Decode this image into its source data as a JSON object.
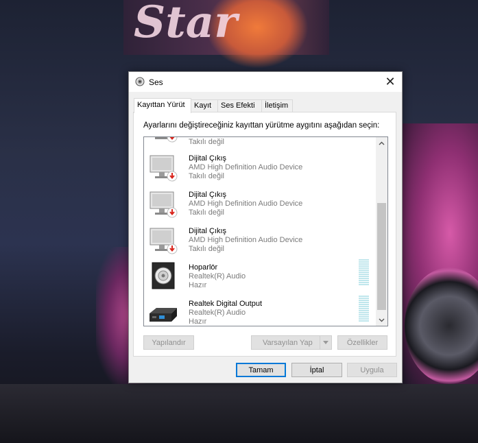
{
  "window": {
    "title": "Ses",
    "close_glyph": "✕"
  },
  "tabs": [
    {
      "label": "Kayıttan Yürüt",
      "active": true
    },
    {
      "label": "Kayıt",
      "active": false
    },
    {
      "label": "Ses Efekti",
      "active": false
    },
    {
      "label": "İletişim",
      "active": false
    }
  ],
  "instruction": "Ayarlarını değiştireceğiniz kayıttan yürütme aygıtını aşağıdan seçin:",
  "devices": [
    {
      "name": "",
      "description": "",
      "status": "Takılı değil",
      "icon": "monitor-disconnected-icon"
    },
    {
      "name": "Dijital Çıkış",
      "description": "AMD High Definition Audio Device",
      "status": "Takılı değil",
      "icon": "monitor-disconnected-icon"
    },
    {
      "name": "Dijital Çıkış",
      "description": "AMD High Definition Audio Device",
      "status": "Takılı değil",
      "icon": "monitor-disconnected-icon"
    },
    {
      "name": "Dijital Çıkış",
      "description": "AMD High Definition Audio Device",
      "status": "Takılı değil",
      "icon": "monitor-disconnected-icon"
    },
    {
      "name": "Hoparlör",
      "description": "Realtek(R) Audio",
      "status": "Hazır",
      "icon": "speaker-icon"
    },
    {
      "name": "Realtek Digital Output",
      "description": "Realtek(R) Audio",
      "status": "Hazır",
      "icon": "digital-output-icon"
    }
  ],
  "buttons": {
    "configure": "Yapılandır",
    "set_default": "Varsayılan Yap",
    "properties": "Özellikler",
    "ok": "Tamam",
    "cancel": "İptal",
    "apply": "Uygula"
  },
  "colors": {
    "accent": "#0078d7",
    "disconnected_badge": "#d9251c",
    "level_meter": "#bfe6ec"
  }
}
